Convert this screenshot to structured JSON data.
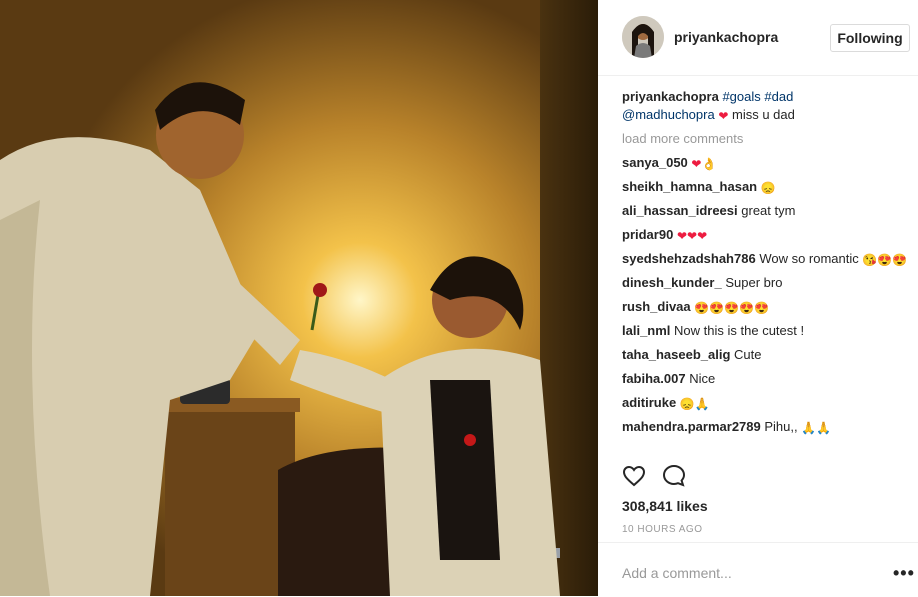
{
  "post": {
    "username": "priyankachopra",
    "follow_label": "Following",
    "caption": {
      "user": "priyankachopra",
      "tags": [
        "#goals",
        "#dad"
      ],
      "mention": "@madhuchopra",
      "text": "miss u dad"
    },
    "load_more": "load more comments",
    "comments": [
      {
        "user": "sanya_050",
        "text": "",
        "emojis": [
          "❤",
          "👌"
        ]
      },
      {
        "user": "sheikh_hamna_hasan",
        "text": "",
        "emojis": [
          "😞"
        ]
      },
      {
        "user": "ali_hassan_idreesi",
        "text": "great tym",
        "emojis": []
      },
      {
        "user": "pridar90",
        "text": "",
        "emojis": [
          "❤",
          "❤",
          "❤"
        ]
      },
      {
        "user": "syedshehzadshah786",
        "text": "Wow so romantic",
        "emojis": [
          "😘",
          "😍",
          "😍"
        ]
      },
      {
        "user": "dinesh_kunder_",
        "text": "Super bro",
        "emojis": []
      },
      {
        "user": "rush_divaa",
        "text": "",
        "emojis": [
          "😍",
          "😍",
          "😍",
          "😍",
          "😍"
        ]
      },
      {
        "user": "lali_nml",
        "text": "Now this is the cutest !",
        "emojis": []
      },
      {
        "user": "taha_haseeb_alig",
        "text": "Cute",
        "emojis": []
      },
      {
        "user": "fabiha.007",
        "text": "Nice",
        "emojis": []
      },
      {
        "user": "aditiruke",
        "text": "",
        "emojis": [
          "😞",
          "🙏"
        ]
      },
      {
        "user": "mahendra.parmar2789",
        "text": "Pihu,,",
        "emojis": [
          "🙏",
          "🙏"
        ]
      }
    ],
    "likes": "308,841 likes",
    "time": "10 HOURS AGO",
    "add_comment_placeholder": "Add a comment...",
    "more_options": "•••",
    "icons": {
      "like": "heart-outline-icon",
      "comment": "speech-bubble-icon",
      "more": "more-options-icon"
    },
    "colors": {
      "link": "#003569",
      "muted": "#999999",
      "text": "#262626"
    }
  }
}
